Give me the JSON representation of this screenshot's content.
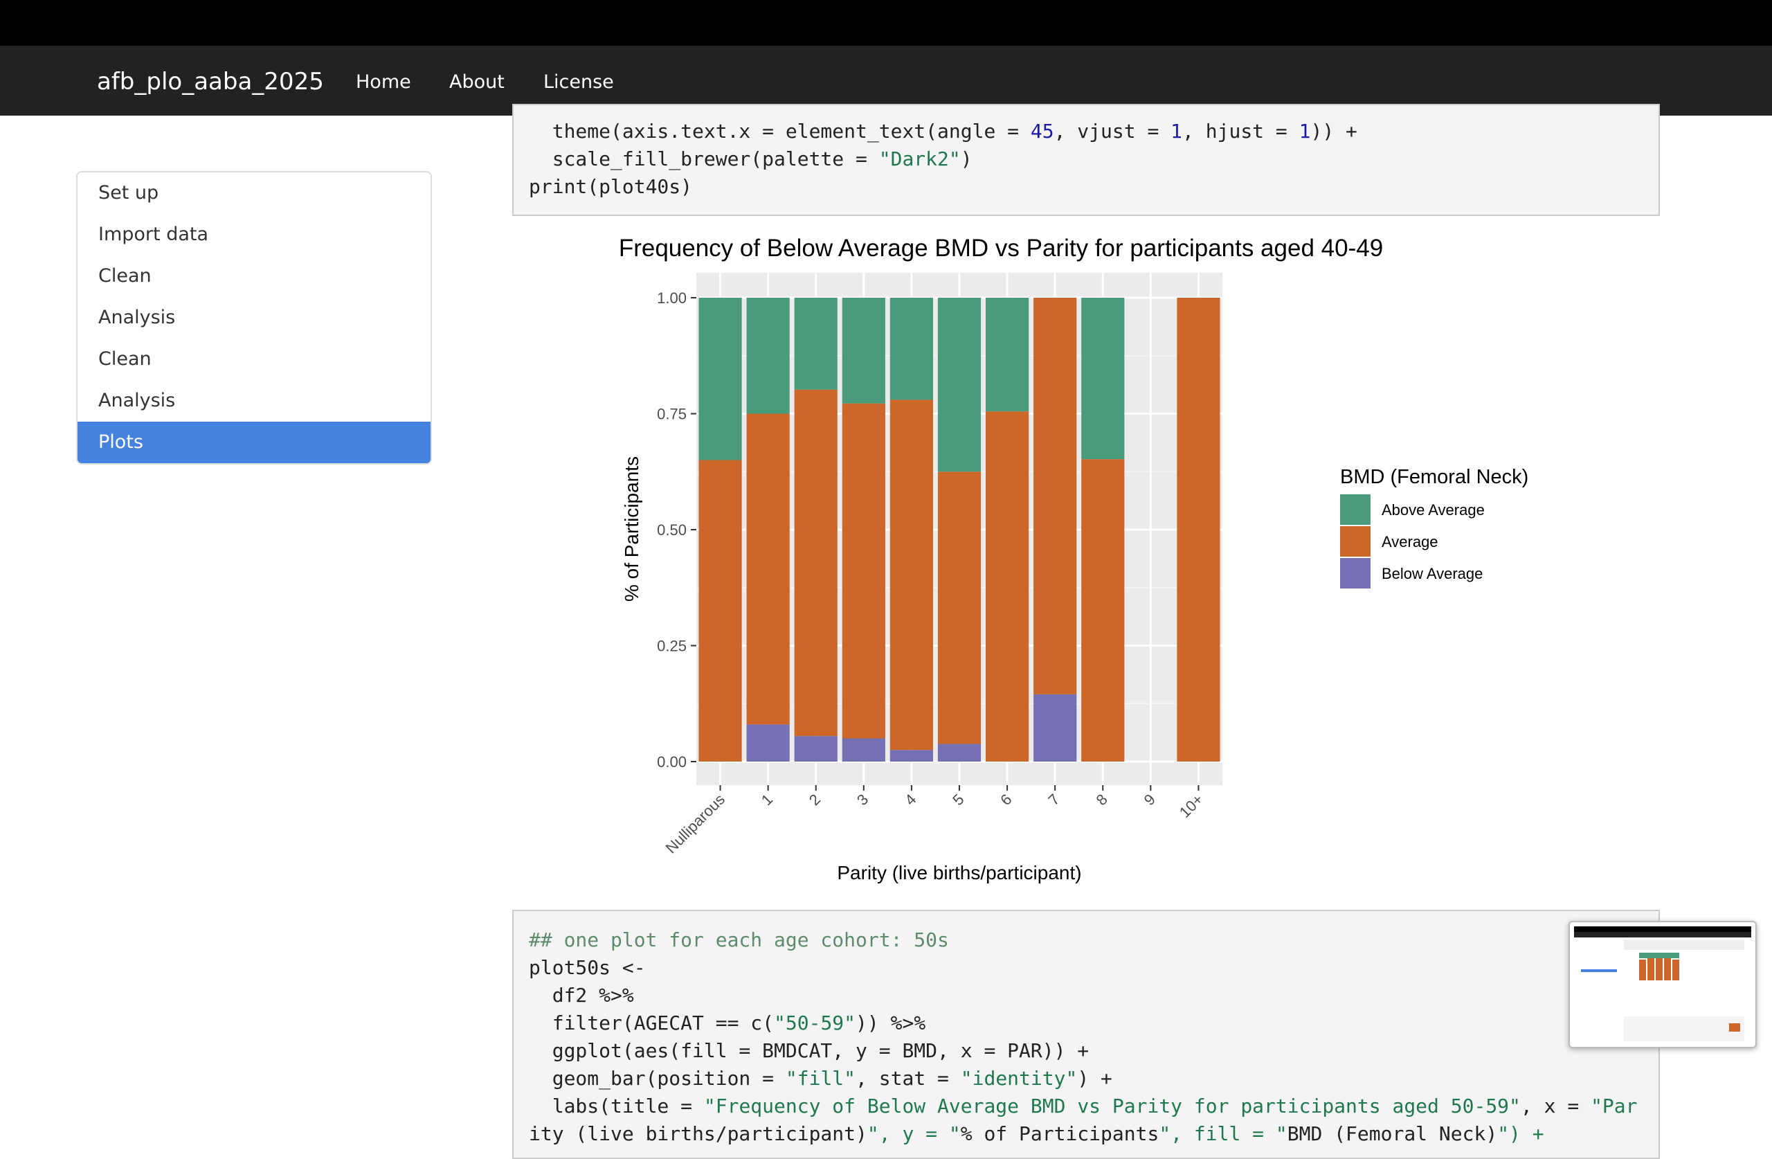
{
  "navbar": {
    "brand": "afb_plo_aaba_2025",
    "links": [
      "Home",
      "About",
      "License"
    ]
  },
  "toc": {
    "items": [
      "Set up",
      "Import data",
      "Clean",
      "Analysis",
      "Clean",
      "Analysis",
      "Plots"
    ],
    "active_index": 6
  },
  "colors": {
    "navbar_bg": "#222222",
    "toc_active": "#4582df",
    "above_average": "#4a9b7a",
    "average": "#cc6629",
    "below_average": "#7570b3",
    "panel_bg": "#ebebeb"
  },
  "code_top": {
    "lines": [
      "  theme(axis.text.x = element_text(angle = 45, vjust = 1, hjust = 1)) +",
      "  scale_fill_brewer(palette = \"Dark2\")",
      "print(plot40s)"
    ]
  },
  "code_bottom": {
    "lines": [
      "## one plot for each age cohort: 50s",
      "plot50s <-",
      "  df2 %>%",
      "  filter(AGECAT == c(\"50-59\")) %>%",
      "  ggplot(aes(fill = BMDCAT, y = BMD, x = PAR)) +",
      "  geom_bar(position = \"fill\", stat = \"identity\") +",
      "  labs(title = \"Frequency of Below Average BMD vs Parity for participants aged 50-59\", x = \"Par",
      "ity (live births/participant)\", y = \"% of Participants\", fill = \"BMD (Femoral Neck)\") +"
    ]
  },
  "chart_data": {
    "type": "bar",
    "title": "Frequency of Below Average BMD vs Parity for participants aged 40-49",
    "xlabel": "Parity (live births/participant)",
    "ylabel": "% of Participants",
    "categories": [
      "Nulliparous",
      "1",
      "2",
      "3",
      "4",
      "5",
      "6",
      "7",
      "8",
      "9",
      "10+"
    ],
    "ylim": [
      0,
      1
    ],
    "yticks": [
      "0.00",
      "0.25",
      "0.50",
      "0.75",
      "1.00"
    ],
    "stacked": true,
    "legend_title": "BMD (Femoral Neck)",
    "legend_position": "right",
    "grid": true,
    "series": [
      {
        "name": "Below Average",
        "values": [
          0,
          0.08,
          0.055,
          0.05,
          0.025,
          0.038,
          0,
          0.145,
          0,
          0,
          0
        ]
      },
      {
        "name": "Average",
        "values": [
          0.65,
          0.67,
          0.747,
          0.722,
          0.755,
          0.587,
          0.755,
          0.855,
          0.652,
          0,
          1.0
        ]
      },
      {
        "name": "Above Average",
        "values": [
          0.35,
          0.25,
          0.198,
          0.228,
          0.22,
          0.375,
          0.245,
          0,
          0.348,
          0,
          0
        ]
      }
    ]
  }
}
